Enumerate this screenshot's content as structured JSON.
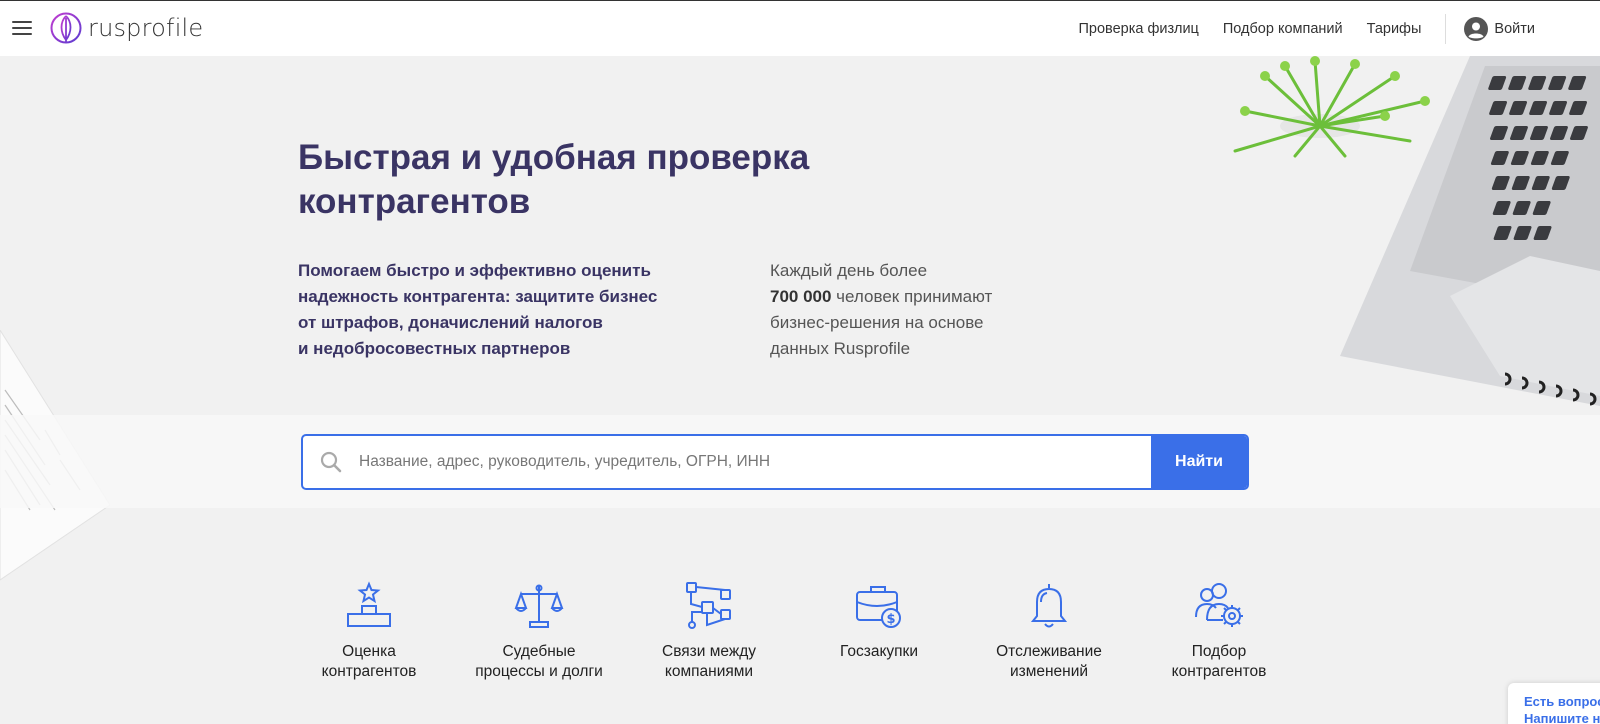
{
  "header": {
    "logo_text": "rusprofile",
    "nav": [
      "Проверка физлиц",
      "Подбор компаний",
      "Тарифы"
    ],
    "login_label": "Войти"
  },
  "hero": {
    "title_line1": "Быстрая и удобная проверка",
    "title_line2": "контрагентов",
    "left_lines": [
      "Помогаем быстро и эффективно оценить",
      "надежность контрагента: защитите бизнес",
      "от штрафов, доначислений налогов",
      "и недобросовестных партнеров"
    ],
    "right_line1": "Каждый день более",
    "right_count": "700 000",
    "right_line2_rest": " человек принимают",
    "right_line3": "бизнес-решения на основе",
    "right_line4": "данных Rusprofile"
  },
  "search": {
    "placeholder": "Название, адрес, руководитель, учредитель, ОГРН, ИНН",
    "value": "",
    "button_label": "Найти"
  },
  "features": [
    {
      "icon": "podium-star-icon",
      "line1": "Оценка",
      "line2": "контрагентов"
    },
    {
      "icon": "scales-icon",
      "line1": "Судебные",
      "line2": "процессы и долги"
    },
    {
      "icon": "network-icon",
      "line1": "Связи между",
      "line2": "компаниями"
    },
    {
      "icon": "briefcase-dollar-icon",
      "line1": "Госзакупки",
      "line2": ""
    },
    {
      "icon": "bell-icon",
      "line1": "Отслеживание",
      "line2": "изменений"
    },
    {
      "icon": "users-gear-icon",
      "line1": "Подбор",
      "line2": "контрагентов"
    }
  ],
  "chat": {
    "line1": "Есть вопрос",
    "line2": "Напишите н"
  },
  "colors": {
    "accent": "#3a6fe8",
    "title": "#3a3464",
    "background": "#f1f1f1"
  }
}
